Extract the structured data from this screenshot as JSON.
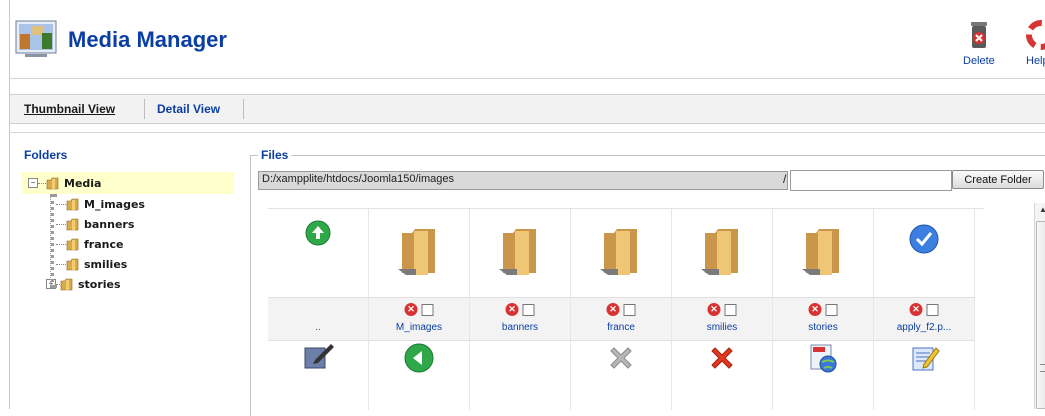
{
  "header": {
    "title": "Media Manager",
    "toolbar": {
      "delete_label": "Delete",
      "help_label": "Help"
    }
  },
  "view_tabs": {
    "thumbnail_label": "Thumbnail View",
    "detail_label": "Detail View"
  },
  "folders": {
    "title": "Folders",
    "root": "Media",
    "items": [
      "M_images",
      "banners",
      "france",
      "smilies",
      "stories"
    ]
  },
  "files": {
    "title": "Files",
    "path": "D:/xampplite/htdocs/Joomla150/images",
    "path_separator": "/",
    "new_folder_value": "",
    "create_folder_label": "Create Folder",
    "up_label": "..",
    "items": [
      {
        "name": "M_images",
        "icon": "folder-icon"
      },
      {
        "name": "banners",
        "icon": "folder-icon"
      },
      {
        "name": "france",
        "icon": "folder-icon"
      },
      {
        "name": "smilies",
        "icon": "folder-icon"
      },
      {
        "name": "stories",
        "icon": "folder-icon"
      },
      {
        "name": "apply_f2.p...",
        "icon": "checkmark-icon"
      }
    ],
    "second_row_icons": [
      "edit-icon",
      "back-arrow-icon",
      "blank",
      "gray-x-icon",
      "red-x-icon",
      "css-globe-icon",
      "notepad-pencil-icon"
    ]
  },
  "colors": {
    "accent": "#0b3ea3",
    "tree_highlight": "#ffffcc",
    "delete_red": "#d93232"
  }
}
